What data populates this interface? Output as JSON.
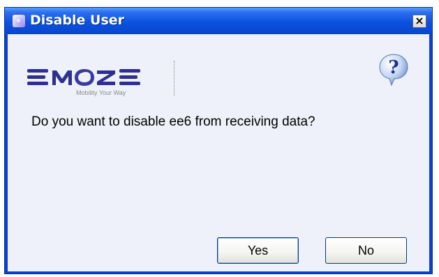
{
  "window": {
    "title": "Disable User",
    "title_icon": "app-icon",
    "close_label": "×"
  },
  "logo": {
    "brand": "EMOZE",
    "tagline": "Mobility Your Way",
    "icon": "emoze-logo"
  },
  "help": {
    "icon": "help-icon",
    "glyph": "?"
  },
  "message": {
    "text": "Do you want to disable ee6 from receiving data?"
  },
  "buttons": {
    "yes_label": "Yes",
    "no_label": "No"
  },
  "colors": {
    "titlebar": "#0a45cf",
    "content_background": "#eef1f9",
    "logo_text": "#2f2f8f",
    "button_border": "#003c74"
  }
}
